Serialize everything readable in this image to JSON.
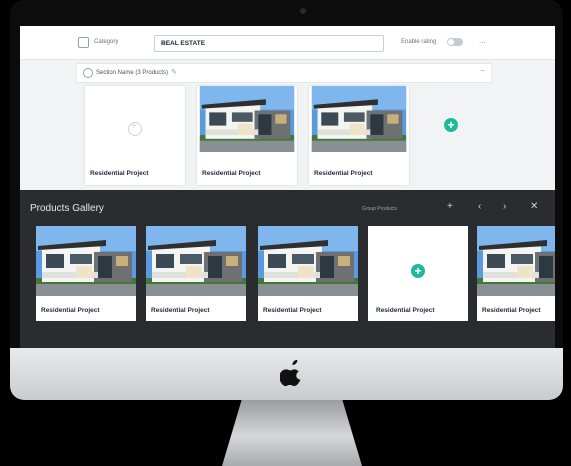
{
  "topbar": {
    "category_label": "Category",
    "category_value": "REAL ESTATE",
    "enable_rating_label": "Enable rating",
    "toggle_state": "off",
    "more_label": "..."
  },
  "section": {
    "title": "Section Name (3 Products)"
  },
  "products": [
    {
      "label": "Residential Project",
      "has_image": false
    },
    {
      "label": "Residential Project",
      "has_image": true
    },
    {
      "label": "Residential Project",
      "has_image": true
    }
  ],
  "gallery": {
    "title": "Products Gallery",
    "toolbar_text": "Group Products",
    "items": [
      {
        "label": "Residential Project",
        "has_image": true
      },
      {
        "label": "Residential Project",
        "has_image": true
      },
      {
        "label": "Residential Project",
        "has_image": true
      },
      {
        "label": "Residential Project",
        "has_image": false
      },
      {
        "label": "Residential Project",
        "has_image": true
      }
    ]
  },
  "colors": {
    "accent": "#1fb89a",
    "gallery_bg": "#2b2c2f",
    "sky": "#4a90d9"
  }
}
